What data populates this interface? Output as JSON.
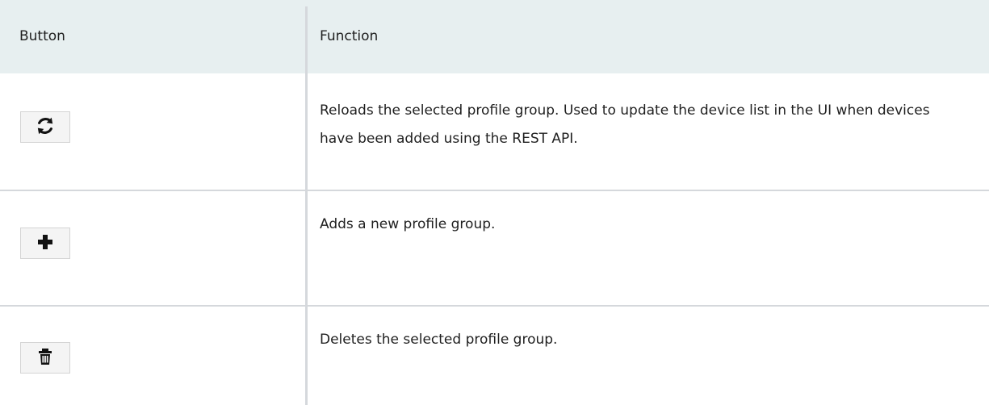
{
  "table": {
    "headers": {
      "button": "Button",
      "function": "Function"
    },
    "rows": [
      {
        "icon": "refresh-icon",
        "function": "Reloads the selected profile group. Used to update the device list in the UI when devices have been added using the REST API."
      },
      {
        "icon": "plus-icon",
        "function": "Adds a new profile group."
      },
      {
        "icon": "trash-icon",
        "function": "Deletes the selected profile group."
      }
    ]
  },
  "colors": {
    "header_background": "#e7eff0",
    "divider": "#d5d8dc",
    "button_background": "#f4f4f4",
    "text": "#1f1f1f"
  }
}
